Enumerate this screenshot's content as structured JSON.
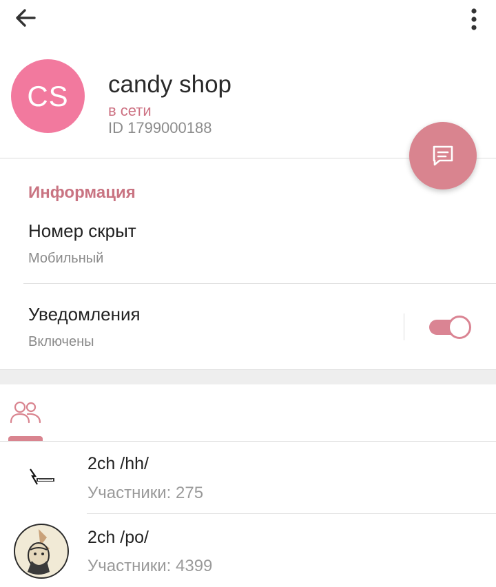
{
  "toolbar": {
    "back_icon": "arrow-left-icon",
    "more_icon": "more-vertical-icon"
  },
  "profile": {
    "initials": "CS",
    "name": "candy shop",
    "status": "в сети",
    "id_text": "ID 1799000188",
    "avatar_color": "#f2799e",
    "fab_icon": "message-icon",
    "fab_color": "#d9848f"
  },
  "info": {
    "section_title": "Информация",
    "phone_value": "Номер скрыт",
    "phone_label": "Мобильный",
    "notifications_title": "Уведомления",
    "notifications_state": "Включены",
    "notifications_enabled": true,
    "accent_color": "#c97482"
  },
  "tabs": {
    "groups_icon": "group-icon"
  },
  "groups": [
    {
      "name": "2ch /hh/",
      "members": "Участники: 275"
    },
    {
      "name": "2ch /po/",
      "members": "Участники: 4399"
    }
  ]
}
